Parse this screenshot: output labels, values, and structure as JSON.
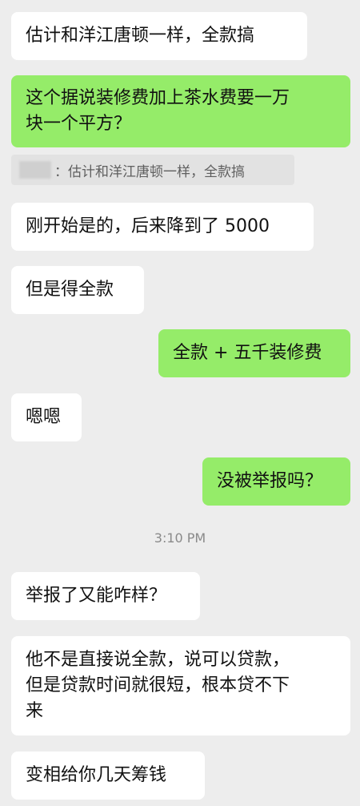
{
  "messages": [
    {
      "side": "in",
      "lines": [
        "估计和洋江唐顿一样，全款搞"
      ]
    },
    {
      "side": "out",
      "lines": [
        "这个据说装修费加上茶水费要一万",
        "块一个平方？"
      ]
    },
    {
      "side": "in",
      "lines": [
        "刚开始是的，后来降到了 5000"
      ]
    },
    {
      "side": "in",
      "lines": [
        "但是得全款"
      ]
    },
    {
      "side": "out",
      "lines": [
        "全款 + 五千装修费"
      ]
    },
    {
      "side": "in",
      "lines": [
        "嗯嗯"
      ]
    },
    {
      "side": "out",
      "lines": [
        "没被举报吗？"
      ]
    },
    {
      "side": "in",
      "lines": [
        "举报了又能咋样？"
      ]
    },
    {
      "side": "in",
      "lines": [
        "他不是直接说全款，说可以贷款，",
        "但是贷款时间就很短，根本贷不下",
        "来"
      ]
    },
    {
      "side": "in",
      "lines": [
        "变相给你几天筹钱"
      ]
    }
  ],
  "quote": {
    "text": "：估计和洋江唐顿一样，全款搞"
  },
  "timestamp": "3:10 PM"
}
